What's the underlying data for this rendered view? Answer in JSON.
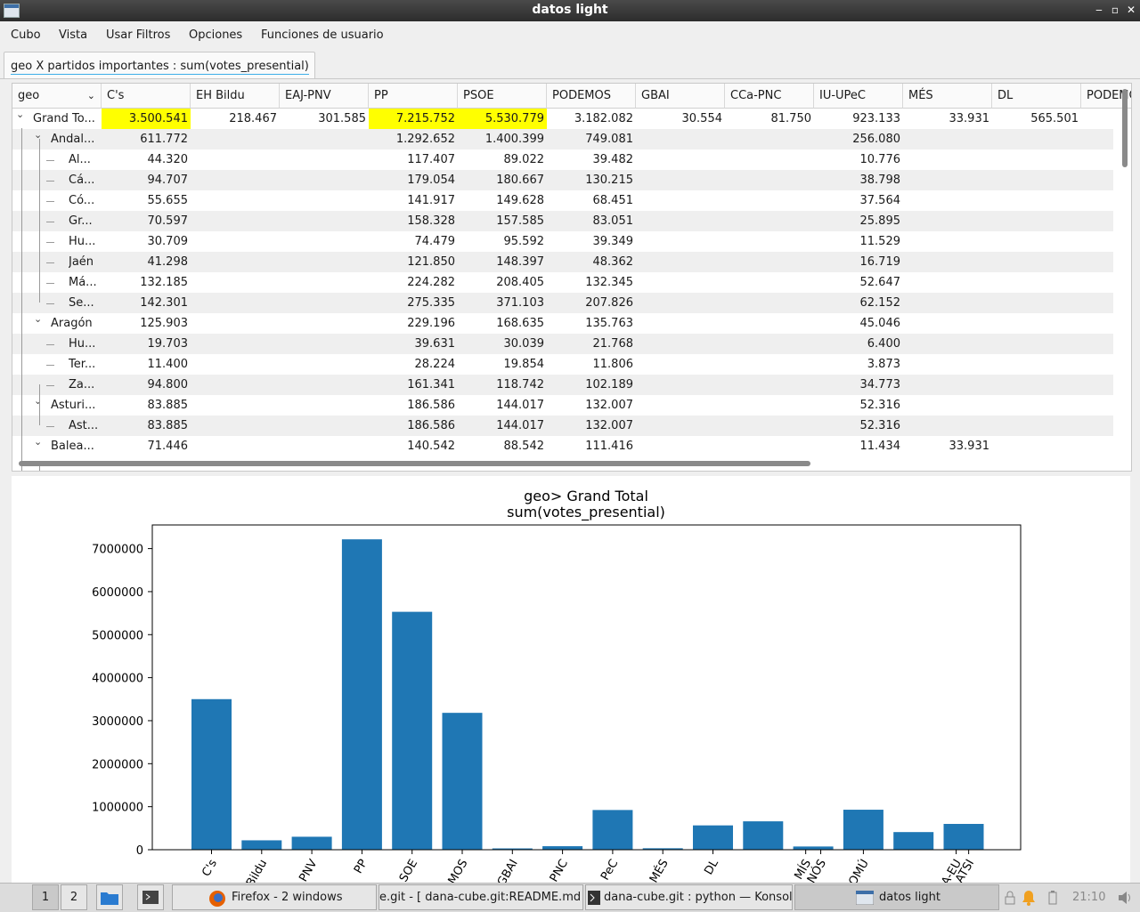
{
  "window": {
    "title": "datos light"
  },
  "menu": [
    "Cubo",
    "Vista",
    "Usar Filtros",
    "Opciones",
    "Funciones de usuario"
  ],
  "tab": {
    "label": "geo X partidos importantes : sum(votes_presential)"
  },
  "table": {
    "geo_header": "geo",
    "columns": [
      "C's",
      "EH Bildu",
      "EAJ-PNV",
      "PP",
      "PSOE",
      "PODEMOS",
      "GBAI",
      "CCa-PNC",
      "IU-UPeC",
      "MÉS",
      "DL",
      "PODEMOS"
    ],
    "rows": [
      {
        "label": "Grand To...",
        "level": 0,
        "expand": true,
        "values": [
          "3.500.541",
          "218.467",
          "301.585",
          "7.215.752",
          "5.530.779",
          "3.182.082",
          "30.554",
          "81.750",
          "923.133",
          "33.931",
          "565.501",
          ""
        ],
        "highlight": [
          0,
          3,
          4
        ]
      },
      {
        "label": "Andal...",
        "level": 1,
        "expand": true,
        "values": [
          "611.772",
          "",
          "",
          "1.292.652",
          "1.400.399",
          "749.081",
          "",
          "",
          "256.080",
          "",
          "",
          ""
        ]
      },
      {
        "label": "Al...",
        "level": 2,
        "values": [
          "44.320",
          "",
          "",
          "117.407",
          "89.022",
          "39.482",
          "",
          "",
          "10.776",
          "",
          "",
          ""
        ]
      },
      {
        "label": "Cá...",
        "level": 2,
        "values": [
          "94.707",
          "",
          "",
          "179.054",
          "180.667",
          "130.215",
          "",
          "",
          "38.798",
          "",
          "",
          ""
        ]
      },
      {
        "label": "Có...",
        "level": 2,
        "values": [
          "55.655",
          "",
          "",
          "141.917",
          "149.628",
          "68.451",
          "",
          "",
          "37.564",
          "",
          "",
          ""
        ]
      },
      {
        "label": "Gr...",
        "level": 2,
        "values": [
          "70.597",
          "",
          "",
          "158.328",
          "157.585",
          "83.051",
          "",
          "",
          "25.895",
          "",
          "",
          ""
        ]
      },
      {
        "label": "Hu...",
        "level": 2,
        "values": [
          "30.709",
          "",
          "",
          "74.479",
          "95.592",
          "39.349",
          "",
          "",
          "11.529",
          "",
          "",
          ""
        ]
      },
      {
        "label": "Jaén",
        "level": 2,
        "values": [
          "41.298",
          "",
          "",
          "121.850",
          "148.397",
          "48.362",
          "",
          "",
          "16.719",
          "",
          "",
          ""
        ]
      },
      {
        "label": "Má...",
        "level": 2,
        "values": [
          "132.185",
          "",
          "",
          "224.282",
          "208.405",
          "132.345",
          "",
          "",
          "52.647",
          "",
          "",
          ""
        ]
      },
      {
        "label": "Se...",
        "level": 2,
        "values": [
          "142.301",
          "",
          "",
          "275.335",
          "371.103",
          "207.826",
          "",
          "",
          "62.152",
          "",
          "",
          ""
        ]
      },
      {
        "label": "Aragón",
        "level": 1,
        "expand": true,
        "values": [
          "125.903",
          "",
          "",
          "229.196",
          "168.635",
          "135.763",
          "",
          "",
          "45.046",
          "",
          "",
          ""
        ]
      },
      {
        "label": "Hu...",
        "level": 2,
        "values": [
          "19.703",
          "",
          "",
          "39.631",
          "30.039",
          "21.768",
          "",
          "",
          "6.400",
          "",
          "",
          ""
        ]
      },
      {
        "label": "Ter...",
        "level": 2,
        "values": [
          "11.400",
          "",
          "",
          "28.224",
          "19.854",
          "11.806",
          "",
          "",
          "3.873",
          "",
          "",
          ""
        ]
      },
      {
        "label": "Za...",
        "level": 2,
        "values": [
          "94.800",
          "",
          "",
          "161.341",
          "118.742",
          "102.189",
          "",
          "",
          "34.773",
          "",
          "",
          ""
        ]
      },
      {
        "label": "Asturi...",
        "level": 1,
        "expand": true,
        "values": [
          "83.885",
          "",
          "",
          "186.586",
          "144.017",
          "132.007",
          "",
          "",
          "52.316",
          "",
          "",
          ""
        ]
      },
      {
        "label": "Ast...",
        "level": 2,
        "values": [
          "83.885",
          "",
          "",
          "186.586",
          "144.017",
          "132.007",
          "",
          "",
          "52.316",
          "",
          "",
          ""
        ]
      },
      {
        "label": "Balea...",
        "level": 1,
        "expand": true,
        "values": [
          "71.446",
          "",
          "",
          "140.542",
          "88.542",
          "111.416",
          "",
          "",
          "11.434",
          "33.931",
          "",
          ""
        ]
      }
    ]
  },
  "chart_data": {
    "type": "bar",
    "title": "geo> Grand Total",
    "subtitle": "sum(votes_presential)",
    "xlabel": "",
    "ylabel": "",
    "ylim": [
      0,
      7550000
    ],
    "yticks": [
      "0",
      "1000000",
      "2000000",
      "3000000",
      "4000000",
      "5000000",
      "6000000",
      "7000000"
    ],
    "ytick_values": [
      0,
      1000000,
      2000000,
      3000000,
      4000000,
      5000000,
      6000000,
      7000000
    ],
    "categories": [
      "C's",
      "Bildu",
      "PNV",
      "PP",
      "SOE",
      "MOS",
      "GBAI",
      "PNC",
      "PeC",
      "MÉS",
      "DL",
      "",
      "MÍS",
      "NÓS",
      "OMÚ",
      "",
      "A-EU",
      "ATSI"
    ],
    "category_positions": [
      0,
      1,
      2,
      3,
      4,
      5,
      6,
      7,
      8,
      9,
      10,
      null,
      11.85,
      12.15,
      13,
      null,
      14.85,
      15.1
    ],
    "values": [
      3500541,
      218467,
      301585,
      7215752,
      5530779,
      3182082,
      30554,
      81750,
      923133,
      33931,
      565501,
      660000,
      75000,
      930000,
      410000,
      600000
    ],
    "color": "#1f77b4",
    "grid": false
  },
  "taskbar": {
    "desktops": [
      "1",
      "2"
    ],
    "tasks": [
      "Firefox - 2 windows",
      "e.git - [ dana-cube.git:README.md",
      "dana-cube.git : python — Konsol",
      "datos light"
    ],
    "clock": "21:10"
  }
}
